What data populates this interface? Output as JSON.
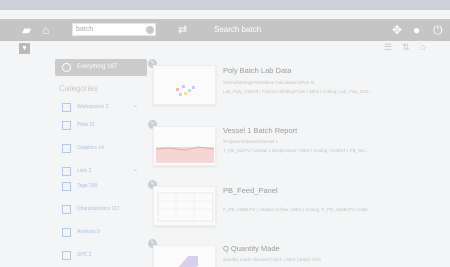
{
  "header": {
    "search_value": "batch",
    "title": "Search batch"
  },
  "sidebar": {
    "all_label": "Everything 167",
    "categories_title": "Categories",
    "items": [
      {
        "label": "Workspaces 2",
        "icon": "workspace-icon"
      },
      {
        "label": "Plots 21",
        "icon": "plot-icon"
      },
      {
        "label": "Graphics 14",
        "icon": "graphic-icon"
      },
      {
        "label": "Lists 2",
        "icon": "list-icon"
      },
      {
        "label": "Tags 200",
        "icon": "tag-icon"
      },
      {
        "label": "Characteristics 117",
        "icon": "characteristic-icon"
      },
      {
        "label": "Analysis 9",
        "icon": "analysis-icon"
      },
      {
        "label": "SPC 2",
        "icon": "spc-icon"
      }
    ]
  },
  "results": [
    {
      "title": "Poly Batch Lab Data",
      "path": "\\Demo\\Manager\\Realtime Calculations\\Part III",
      "meta": "Lab_Poly_DS818 | Polymer Melting Point | MES | Analog, Lab_Poly_DS1..."
    },
    {
      "title": "Vessel 1 Batch Report",
      "path": "\\Polymers\\Vessels\\Vessel 1",
      "meta": "T_PB_Vel.PV | Vessel 1 temperature | MES | Analog | EVENT | PB_Ste..."
    },
    {
      "title": "PB_Feed_Panel",
      "path": "",
      "meta": "P_PB_AddB.PV | Additive B flow | MES | Analog, P_PB_AddB.PV | Addit..."
    },
    {
      "title": "Q Quantity Made",
      "path": "",
      "meta": "quantity made standard batch | MES | Batch SPC"
    }
  ]
}
